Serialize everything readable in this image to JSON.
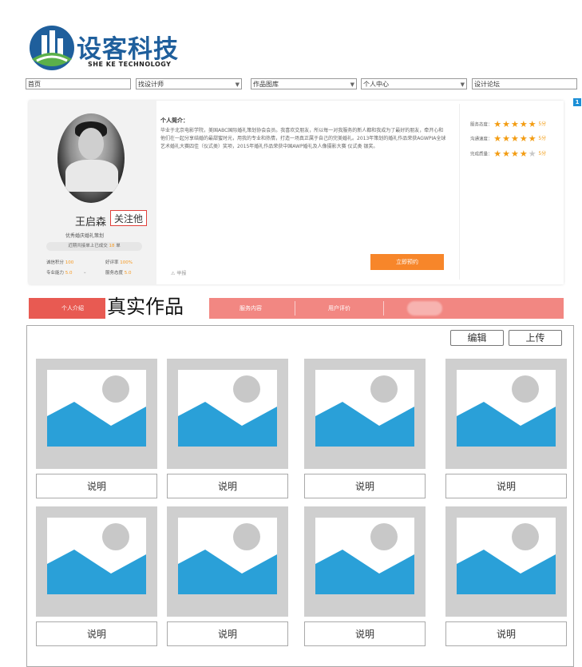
{
  "brand": {
    "name_cn": "设客科技",
    "name_en": "SHE KE TECHNOLOGY",
    "colors": {
      "blue": "#1f5f9c",
      "green": "#5bb04a"
    }
  },
  "nav": {
    "home": "首页",
    "find_designer": "找设计师",
    "gallery": "作品图库",
    "personal_center": "个人中心",
    "forum": "设计论坛"
  },
  "profile": {
    "name": "王启森",
    "follow_label": "关注他",
    "title": "优秀婚庆婚礼策划",
    "order_prefix": "近期共接单上已成交",
    "order_count": "18",
    "order_suffix": "单",
    "stats": {
      "credit_label": "诚信积分",
      "credit_value": "100",
      "praise_label": "好评率",
      "praise_value": "100%",
      "skill_label": "专业能力",
      "skill_value": "5.0",
      "service_label": "服务态度",
      "service_value": "5.0"
    },
    "intro_title": "个人简介：",
    "intro_text": "毕业于北京电影学院，美国ABC国际婚礼策划协会会员。我喜欢交朋友，所以每一对我服务的新人都和我成为了最好的朋友，牵开心和他们在一起分享结婚的最甜蜜时光，用我的专业和热情，打造一场真正属于自己的完美婚礼。2013年策划的婚礼作品荣获AGWPIA全球艺术婚礼大赛四佳（仪式类）奖项，2015年婚礼作品荣获中国AWP婚礼及人像摄影大赛 仪式类 银奖。",
    "report_label": "举报",
    "book_button": "立即预约",
    "badge": "1",
    "ratings": [
      {
        "label": "服务态度：",
        "stars": 5,
        "score": "5分"
      },
      {
        "label": "沟通速度：",
        "stars": 5,
        "score": "5分"
      },
      {
        "label": "完成质量：",
        "stars": 4,
        "score": "5分"
      }
    ]
  },
  "tabs": {
    "intro": "个人介绍",
    "works": "真实作品",
    "service": "服务内容",
    "reviews": "用户评价"
  },
  "gallery": {
    "edit_button": "编辑",
    "upload_button": "上传",
    "items": [
      {
        "caption": "说明"
      },
      {
        "caption": "说明"
      },
      {
        "caption": "说明"
      },
      {
        "caption": "说明"
      },
      {
        "caption": "说明"
      },
      {
        "caption": "说明"
      },
      {
        "caption": "说明"
      },
      {
        "caption": "说明"
      }
    ],
    "colors": {
      "placeholder_bg": "#cfcfcf",
      "mountain": "#2aa0d8",
      "sun": "#c8c8c8"
    }
  }
}
